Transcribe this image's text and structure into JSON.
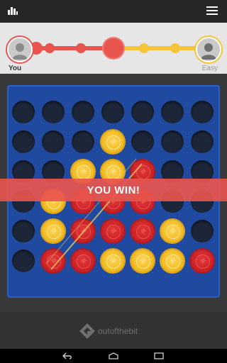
{
  "players": {
    "you": {
      "label": "You",
      "color": "#e8554e"
    },
    "opponent": {
      "label": "Easy",
      "color": "#f4c43a"
    }
  },
  "progress": {
    "current_step": 5,
    "total_steps": 9
  },
  "board": {
    "columns": 7,
    "rows": 6,
    "grid": [
      [
        "empty",
        "empty",
        "empty",
        "empty",
        "empty",
        "empty",
        "empty"
      ],
      [
        "empty",
        "empty",
        "empty",
        "yellow",
        "empty",
        "empty",
        "empty"
      ],
      [
        "empty",
        "empty",
        "yellow",
        "yellow",
        "red",
        "empty",
        "empty"
      ],
      [
        "empty",
        "yellow",
        "red",
        "red",
        "red",
        "empty",
        "empty"
      ],
      [
        "empty",
        "yellow",
        "red",
        "red",
        "red",
        "yellow",
        "empty"
      ],
      [
        "empty",
        "red",
        "red",
        "yellow",
        "yellow",
        "yellow",
        "red"
      ]
    ],
    "colors": {
      "board": "#1f4aa0",
      "red": "#c81f24",
      "yellow": "#f0b81c"
    }
  },
  "result": {
    "text": "YOU WIN!"
  },
  "brand": {
    "text": "outofthebit"
  },
  "icons": {
    "stats": "bar-chart-icon",
    "menu": "hamburger-menu-icon",
    "back": "back-icon",
    "home": "home-icon",
    "recents": "recents-icon"
  }
}
